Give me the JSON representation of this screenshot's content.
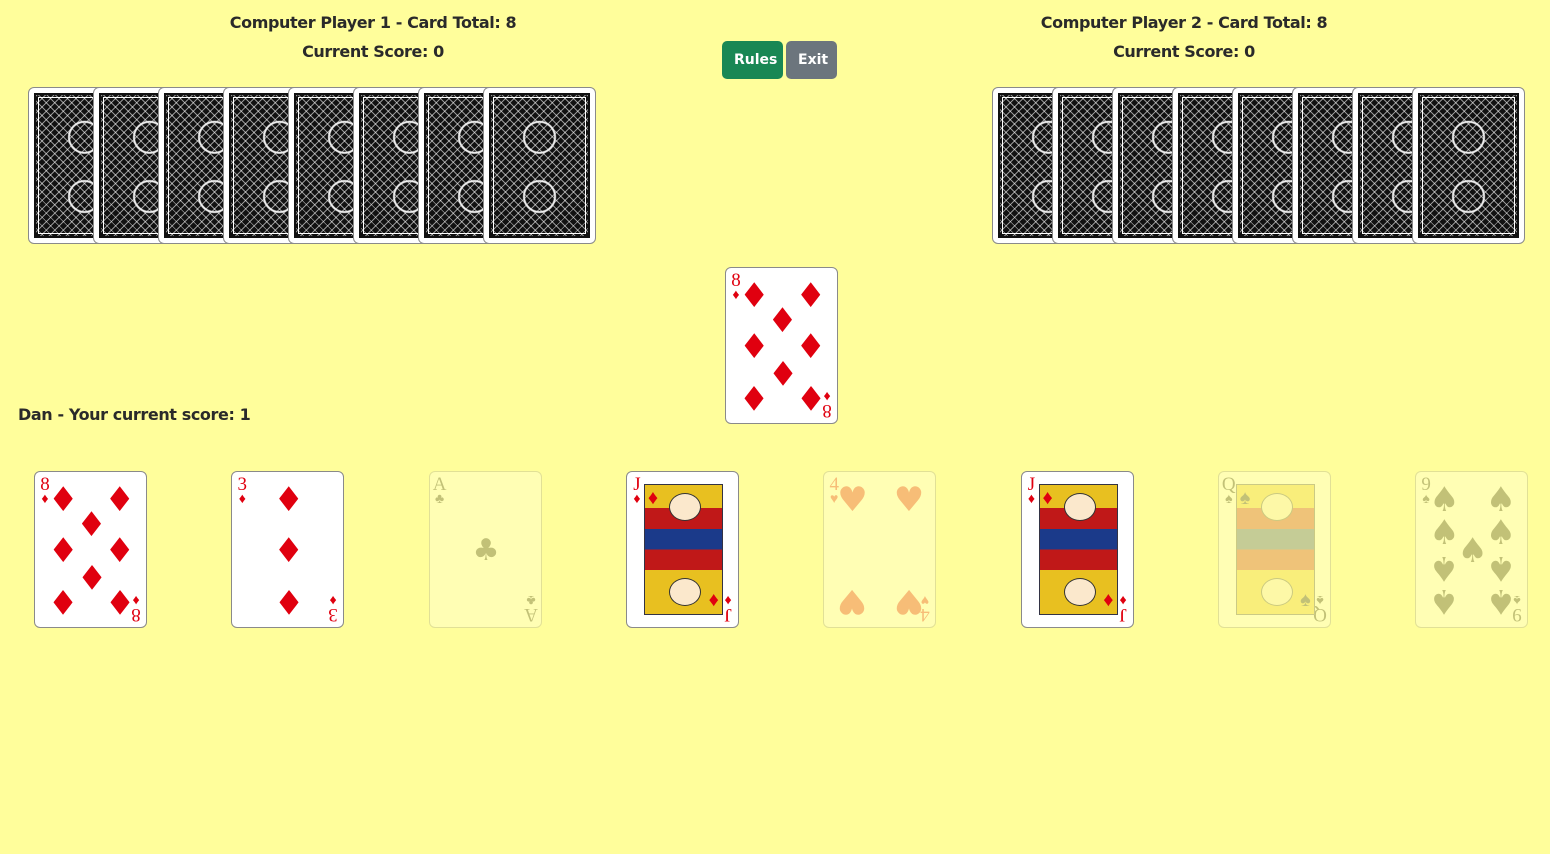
{
  "players": {
    "cp1": {
      "title": "Computer Player 1 - Card Total: 8",
      "score": "Current Score: 0",
      "cards": 8
    },
    "cp2": {
      "title": "Computer Player 2 - Card Total: 8",
      "score": "Current Score: 0",
      "cards": 8
    }
  },
  "toolbar": {
    "rules_label": "Rules",
    "exit_label": "Exit"
  },
  "you": {
    "label": "Dan - Your current score: 1"
  },
  "discard": {
    "rank": "8",
    "suit": "diamonds",
    "suit_glyph": "♦",
    "color": "red"
  },
  "hand": [
    {
      "rank": "8",
      "suit": "diamonds",
      "suit_glyph": "♦",
      "color": "red",
      "playable": true
    },
    {
      "rank": "3",
      "suit": "diamonds",
      "suit_glyph": "♦",
      "color": "red",
      "playable": true
    },
    {
      "rank": "A",
      "suit": "clubs",
      "suit_glyph": "♣",
      "color": "black",
      "playable": false
    },
    {
      "rank": "J",
      "suit": "diamonds",
      "suit_glyph": "♦",
      "color": "red",
      "playable": true
    },
    {
      "rank": "4",
      "suit": "hearts",
      "suit_glyph": "♥",
      "color": "red",
      "playable": false
    },
    {
      "rank": "J",
      "suit": "diamonds",
      "suit_glyph": "♦",
      "color": "red",
      "playable": true
    },
    {
      "rank": "Q",
      "suit": "spades",
      "suit_glyph": "♠",
      "color": "black",
      "playable": false
    },
    {
      "rank": "9",
      "suit": "spades",
      "suit_glyph": "♠",
      "color": "black",
      "playable": false
    }
  ],
  "colors": {
    "background": "#fffe9b",
    "rules": "#198754",
    "exit": "#6c757d",
    "red_suit": "#e0000f"
  }
}
